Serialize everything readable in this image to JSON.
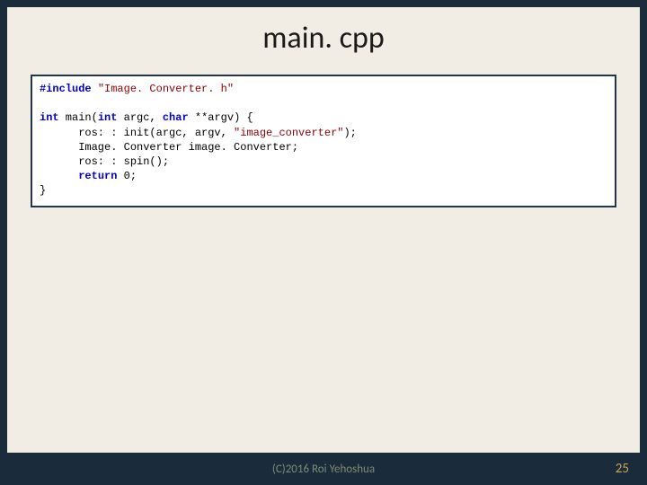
{
  "slide": {
    "title": "main. cpp",
    "code": {
      "include_kw": "#include",
      "include_file": "\"Image. Converter. h\"",
      "int1": "int",
      "main_open": " main(",
      "int2": "int",
      "argc": " argc, ",
      "char": "char",
      "argv_open": " **argv) {",
      "line_init_a": "      ros: : init(argc, argv, ",
      "line_init_str": "\"image_converter\"",
      "line_init_b": ");",
      "line_conv": "      Image. Converter image. Converter;",
      "line_spin": "      ros: : spin();",
      "return_kw": "return",
      "return_rest": " 0;",
      "brace": "}"
    }
  },
  "footer": {
    "copyright": "(C)2016 Roi Yehoshua",
    "page": "25"
  }
}
